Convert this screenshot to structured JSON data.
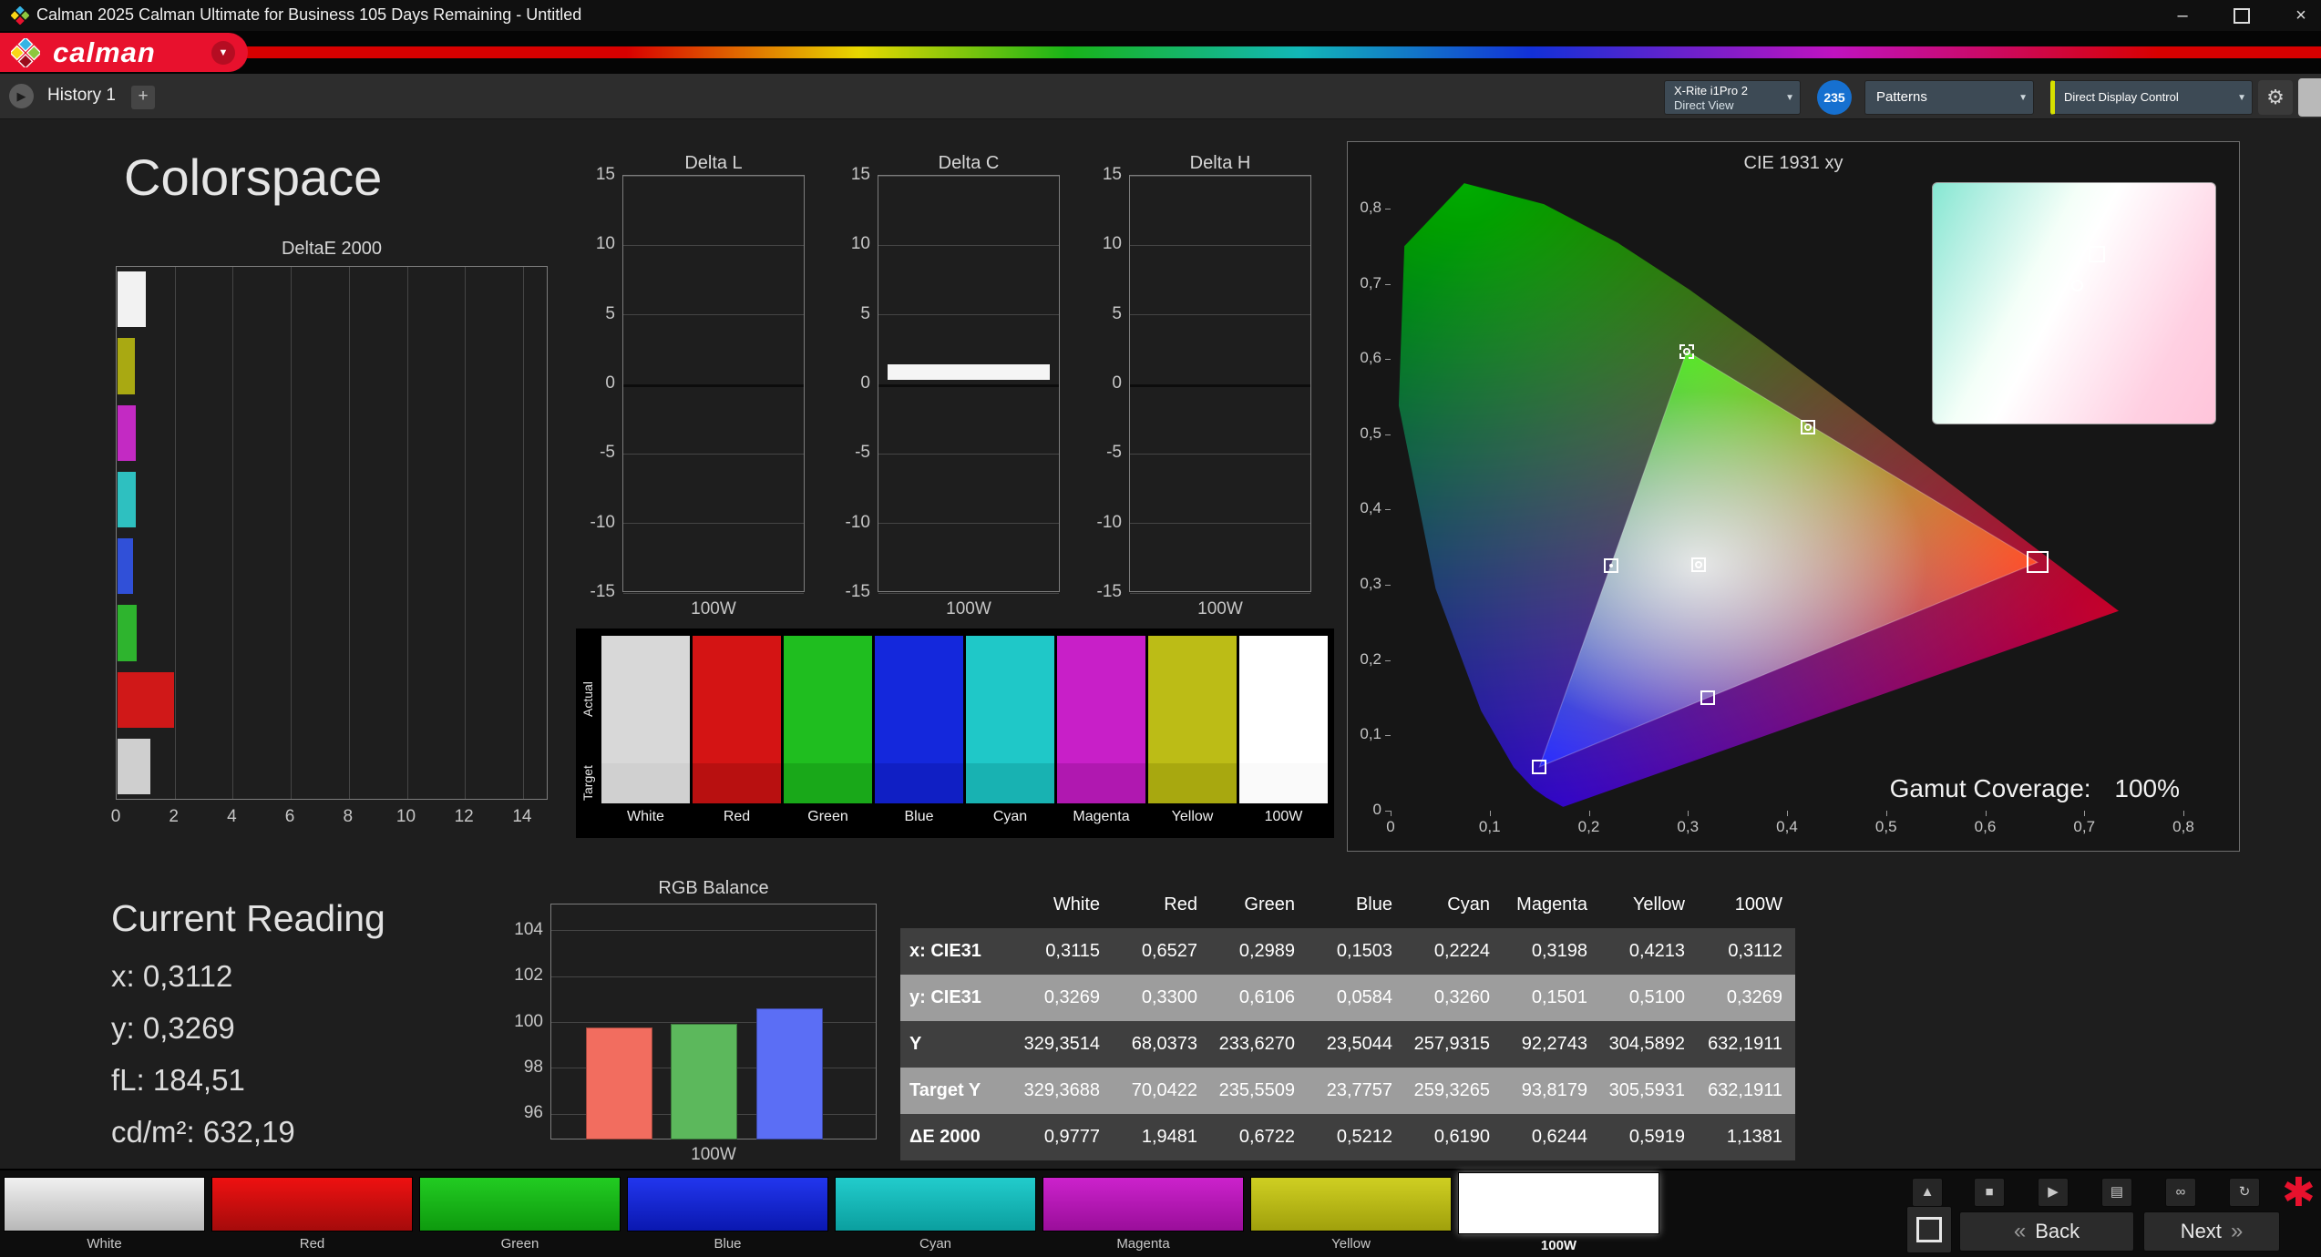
{
  "window": {
    "title": "Calman 2025 Calman Ultimate for Business 105 Days Remaining  - Untitled"
  },
  "icons": {
    "dropdown": "▼",
    "play": "▶",
    "stop": "■",
    "up": "▲",
    "save": "▤",
    "link": "∞",
    "refresh": "↻",
    "close": "×",
    "minimize": "–",
    "back_chevron": "«",
    "next_chevron": "»",
    "asterisk": "✱",
    "gear": "⚙"
  },
  "brand": {
    "logo_text": "calman"
  },
  "tab_bar": {
    "history_tab": "History 1",
    "add_tab": "+"
  },
  "device_bar": {
    "meter": {
      "line1": "X-Rite i1Pro 2",
      "line2": "Direct View"
    },
    "reads_badge": "235",
    "patterns": "Patterns",
    "display_control": "Direct Display Control"
  },
  "main": {
    "heading": "Colorspace",
    "current_reading": {
      "heading": "Current Reading",
      "lines": [
        "x: 0,3112",
        "y: 0,3269",
        "fL: 184,51",
        "cd/m²: 632,19"
      ]
    },
    "gamut_coverage": {
      "label": "Gamut Coverage:",
      "value": "100%"
    }
  },
  "swatch_grid": {
    "row_labels": [
      "Actual",
      "Target"
    ],
    "columns": [
      {
        "label": "White",
        "actual": "#d8d8d8",
        "target": "#d0d0d0"
      },
      {
        "label": "Red",
        "actual": "#d41414",
        "target": "#b81010"
      },
      {
        "label": "Green",
        "actual": "#1fbe1f",
        "target": "#19a819"
      },
      {
        "label": "Blue",
        "actual": "#1428dc",
        "target": "#101fc4"
      },
      {
        "label": "Cyan",
        "actual": "#1fc8c8",
        "target": "#18b2b2"
      },
      {
        "label": "Magenta",
        "actual": "#c81fc8",
        "target": "#b018b0"
      },
      {
        "label": "Yellow",
        "actual": "#bcbc16",
        "target": "#a8a80f"
      },
      {
        "label": "100W",
        "actual": "#ffffff",
        "target": "#fafafa"
      }
    ]
  },
  "pattern_bar": {
    "buttons": [
      {
        "label": "White",
        "c1": "#f0f0f0",
        "c2": "#b8b8b8",
        "active": false
      },
      {
        "label": "Red",
        "c1": "#ee1111",
        "c2": "#a50b0b",
        "active": false
      },
      {
        "label": "Green",
        "c1": "#22cc22",
        "c2": "#0e9a0e",
        "active": false
      },
      {
        "label": "Blue",
        "c1": "#2236ee",
        "c2": "#0a18b0",
        "active": false
      },
      {
        "label": "Cyan",
        "c1": "#22cccc",
        "c2": "#0b9f9f",
        "active": false
      },
      {
        "label": "Magenta",
        "c1": "#cc22cc",
        "c2": "#9a0e9a",
        "active": false
      },
      {
        "label": "Yellow",
        "c1": "#cfcf22",
        "c2": "#a0a00c",
        "active": false
      },
      {
        "label": "100W",
        "c1": "#ffffff",
        "c2": "#f0f0f0",
        "active": true
      }
    ]
  },
  "transport": {
    "back": "Back",
    "next": "Next"
  },
  "chart_data": [
    {
      "id": "deltae2000",
      "type": "bar",
      "orientation": "horizontal",
      "title": "DeltaE 2000",
      "categories": [
        "White",
        "Yellow",
        "Magenta",
        "Cyan",
        "Blue",
        "Green",
        "Red",
        "100W"
      ],
      "values": [
        0.9777,
        0.5919,
        0.6244,
        0.619,
        0.5212,
        0.6722,
        1.9481,
        1.1381
      ],
      "colors": [
        "#f2f2f2",
        "#a9a912",
        "#c32ac3",
        "#2ec0c0",
        "#3050d8",
        "#2eb42e",
        "#d01818",
        "#cfcfcf"
      ],
      "xlim": [
        0,
        14
      ],
      "xticks": [
        "0",
        "2",
        "4",
        "6",
        "8",
        "10",
        "12",
        "14"
      ],
      "grid": true
    },
    {
      "id": "delta_l",
      "type": "bar",
      "title": "Delta L",
      "categories": [
        "100W"
      ],
      "values": [
        0
      ],
      "ylim": [
        -15,
        15
      ],
      "yticks": [
        "15",
        "10",
        "5",
        "0",
        "-5",
        "-10",
        "-15"
      ],
      "xlabel": "100W",
      "bar_color": "#f5f5f5"
    },
    {
      "id": "delta_c",
      "type": "bar",
      "title": "Delta C",
      "categories": [
        "100W"
      ],
      "values": [
        0.9
      ],
      "ylim": [
        -15,
        15
      ],
      "yticks": [
        "15",
        "10",
        "5",
        "0",
        "-5",
        "-10",
        "-15"
      ],
      "xlabel": "100W",
      "bar_color": "#f5f5f5"
    },
    {
      "id": "delta_h",
      "type": "bar",
      "title": "Delta H",
      "categories": [
        "100W"
      ],
      "values": [
        0
      ],
      "ylim": [
        -15,
        15
      ],
      "yticks": [
        "15",
        "10",
        "5",
        "0",
        "-5",
        "-10",
        "-15"
      ],
      "xlabel": "100W",
      "bar_color": "#f5f5f5"
    },
    {
      "id": "rgb_balance",
      "type": "bar",
      "title": "RGB Balance",
      "categories": [
        "Red",
        "Green",
        "Blue"
      ],
      "values": [
        99.8,
        99.95,
        100.6
      ],
      "colors": [
        "#f26d5f",
        "#5cb85c",
        "#5b6ef5"
      ],
      "ylim": [
        94.85,
        105.15
      ],
      "yticks": [
        "104",
        "102",
        "100",
        "98",
        "96"
      ],
      "xlabel": "100W"
    },
    {
      "id": "cie1931",
      "type": "scatter",
      "title": "CIE 1931 xy",
      "xlim": [
        0,
        0.8
      ],
      "ylim": [
        0,
        0.8
      ],
      "xticks": [
        "0",
        "0,1",
        "0,2",
        "0,3",
        "0,4",
        "0,5",
        "0,6",
        "0,7",
        "0,8"
      ],
      "yticks": [
        "0,8",
        "0,7",
        "0,6",
        "0,5",
        "0,4",
        "0,3",
        "0,2",
        "0,1",
        "0"
      ],
      "points": [
        {
          "name": "white-point",
          "x": 0.3112,
          "y": 0.3269,
          "style": "square-circle"
        },
        {
          "name": "red-primary",
          "x": 0.6527,
          "y": 0.33,
          "style": "square-large"
        },
        {
          "name": "green-primary",
          "x": 0.2989,
          "y": 0.6106,
          "style": "square-dashed"
        },
        {
          "name": "blue-primary",
          "x": 0.1503,
          "y": 0.0584,
          "style": "square"
        },
        {
          "name": "cyan-secondary",
          "x": 0.2224,
          "y": 0.326,
          "style": "square-dot"
        },
        {
          "name": "magenta-secondary",
          "x": 0.3198,
          "y": 0.1501,
          "style": "square"
        },
        {
          "name": "yellow-secondary",
          "x": 0.4213,
          "y": 0.51,
          "style": "square-circle"
        }
      ]
    },
    {
      "id": "measurement_table",
      "type": "table",
      "columns": [
        "",
        "White",
        "Red",
        "Green",
        "Blue",
        "Cyan",
        "Magenta",
        "Yellow",
        "100W"
      ],
      "rows": [
        {
          "label": "x: CIE31",
          "values": [
            "0,3115",
            "0,6527",
            "0,2989",
            "0,1503",
            "0,2224",
            "0,3198",
            "0,4213",
            "0,3112"
          ]
        },
        {
          "label": "y: CIE31",
          "values": [
            "0,3269",
            "0,3300",
            "0,6106",
            "0,0584",
            "0,3260",
            "0,1501",
            "0,5100",
            "0,3269"
          ]
        },
        {
          "label": "Y",
          "values": [
            "329,3514",
            "68,0373",
            "233,6270",
            "23,5044",
            "257,9315",
            "92,2743",
            "304,5892",
            "632,1911"
          ]
        },
        {
          "label": "Target Y",
          "values": [
            "329,3688",
            "70,0422",
            "235,5509",
            "23,7757",
            "259,3265",
            "93,8179",
            "305,5931",
            "632,1911"
          ]
        },
        {
          "label": "ΔE 2000",
          "values": [
            "0,9777",
            "1,9481",
            "0,6722",
            "0,5212",
            "0,6190",
            "0,6244",
            "0,5919",
            "1,1381"
          ]
        }
      ]
    }
  ]
}
